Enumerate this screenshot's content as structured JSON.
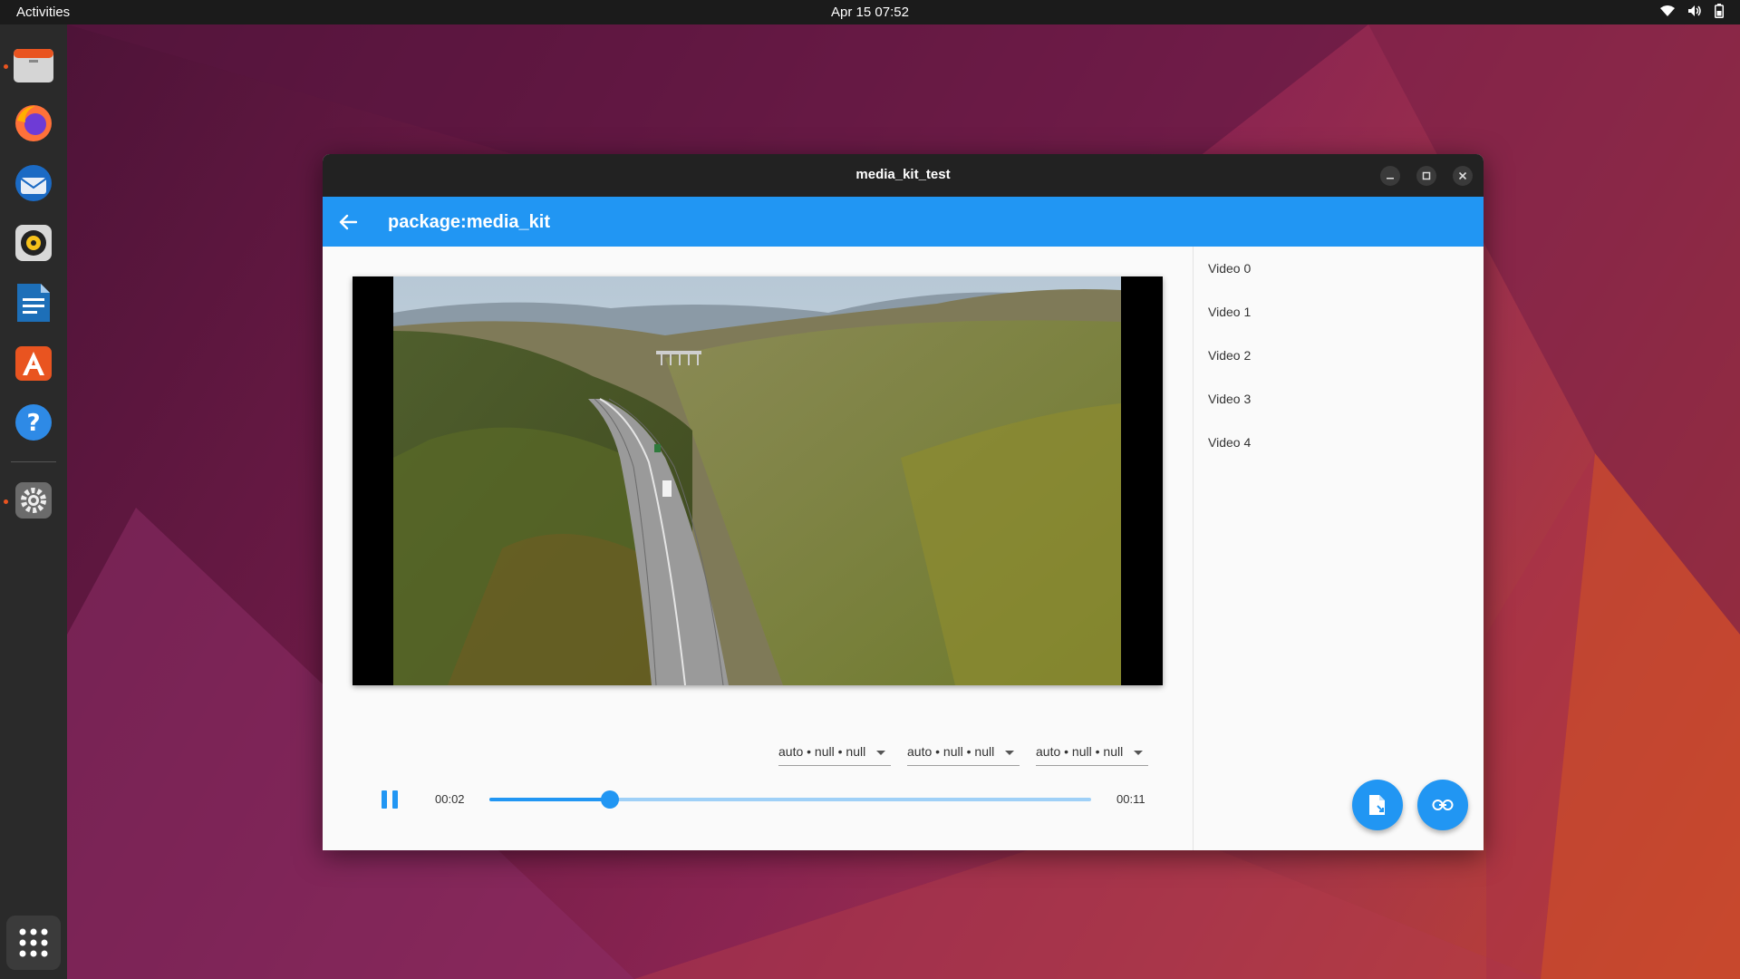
{
  "topbar": {
    "activities": "Activities",
    "datetime": "Apr 15  07:52"
  },
  "dock": {
    "items": [
      {
        "name": "files-icon",
        "running": true
      },
      {
        "name": "firefox-icon",
        "running": false
      },
      {
        "name": "thunderbird-icon",
        "running": false
      },
      {
        "name": "rhythmbox-icon",
        "running": false
      },
      {
        "name": "libreoffice-writer-icon",
        "running": false
      },
      {
        "name": "app-center-icon",
        "running": false
      },
      {
        "name": "help-icon",
        "running": false
      },
      {
        "name": "settings-icon",
        "running": true
      },
      {
        "name": "show-apps-icon",
        "running": false
      }
    ]
  },
  "window": {
    "title": "media_kit_test",
    "appbar_title": "package:media_kit"
  },
  "player": {
    "position": "00:02",
    "duration": "00:11",
    "progress_fraction": 0.2,
    "selects": [
      "auto • null • null",
      "auto • null • null",
      "auto • null • null"
    ]
  },
  "playlist": [
    "Video 0",
    "Video 1",
    "Video 2",
    "Video 3",
    "Video 4"
  ],
  "colors": {
    "accent": "#2196f3",
    "titlebar": "#222222",
    "dock": "#2a2a2a"
  }
}
